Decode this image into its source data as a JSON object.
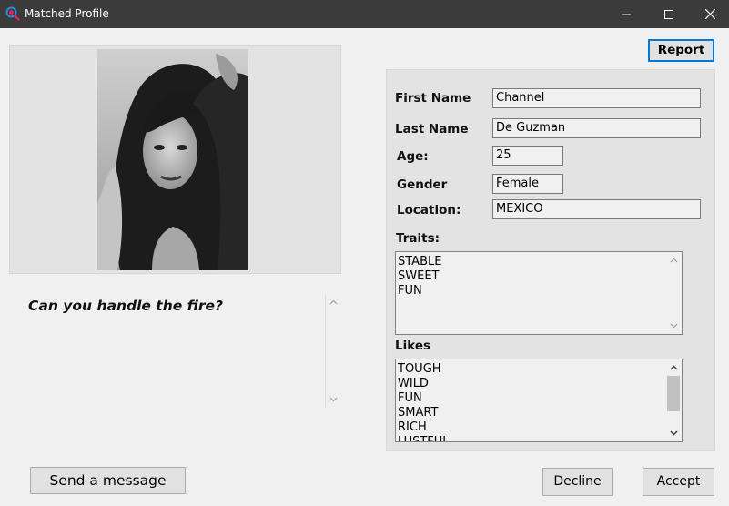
{
  "window": {
    "title": "Matched Profile"
  },
  "profile": {
    "tagline": "Can you handle the fire?",
    "first_name_label": "First Name",
    "first_name": "Channel",
    "last_name_label": "Last Name",
    "last_name": "De Guzman",
    "age_label": "Age:",
    "age": "25",
    "gender_label": "Gender",
    "gender": "Female",
    "location_label": "Location:",
    "location": "MEXICO",
    "traits_label": "Traits:",
    "traits": [
      "STABLE",
      "SWEET",
      "FUN"
    ],
    "likes_label": "Likes",
    "likes": [
      "TOUGH",
      "WILD",
      "FUN",
      "SMART",
      "RICH",
      "LUSTFUL"
    ]
  },
  "buttons": {
    "report": "Report",
    "send_message": "Send a message",
    "decline": "Decline",
    "accept": "Accept"
  },
  "icons": {
    "app": "search-heart-icon",
    "minimize": "minimize-icon",
    "maximize": "maximize-icon",
    "close": "close-icon"
  },
  "colors": {
    "titlebar": "#3b3b3b",
    "focus_border": "#0078d7",
    "app_icon_ring": "#2b8ae0",
    "app_icon_accent": "#e0245e"
  }
}
